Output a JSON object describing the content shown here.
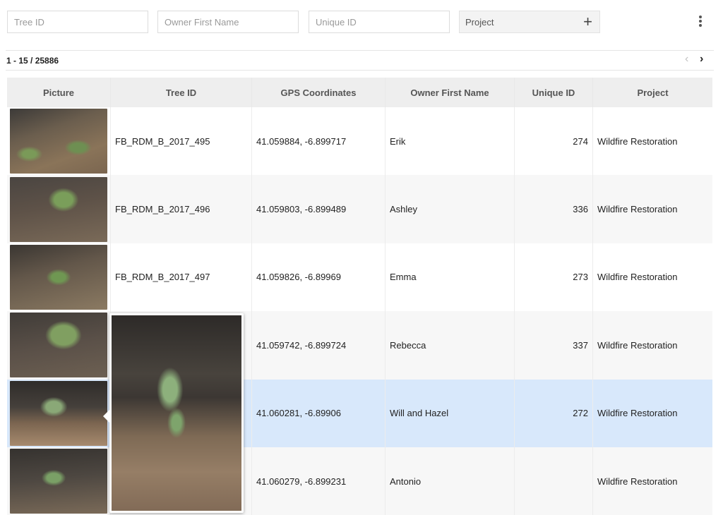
{
  "filters": {
    "tree_id_placeholder": "Tree ID",
    "owner_first_name_placeholder": "Owner First Name",
    "unique_id_placeholder": "Unique ID",
    "project_label": "Project",
    "project_icon": "plus-icon",
    "more_icon": "more-vertical-icon"
  },
  "pager": {
    "range": "1 - 15 / 25886",
    "prev_icon": "‹",
    "next_icon": "›",
    "prev_enabled": false,
    "next_enabled": true
  },
  "table": {
    "columns": [
      "Picture",
      "Tree ID",
      "GPS Coordinates",
      "Owner First Name",
      "Unique ID",
      "Project"
    ],
    "rows": [
      {
        "picture": "sapling-photo",
        "tree_id": "FB_RDM_B_2017_495",
        "gps": "41.059884, -6.899717",
        "owner": "Erik",
        "unique_id": "274",
        "project": "Wildfire Restoration"
      },
      {
        "picture": "sapling-photo",
        "tree_id": "FB_RDM_B_2017_496",
        "gps": "41.059803, -6.899489",
        "owner": "Ashley",
        "unique_id": "336",
        "project": "Wildfire Restoration"
      },
      {
        "picture": "sapling-photo",
        "tree_id": "FB_RDM_B_2017_497",
        "gps": "41.059826, -6.89969",
        "owner": "Emma",
        "unique_id": "273",
        "project": "Wildfire Restoration"
      },
      {
        "picture": "sapling-photo",
        "tree_id": "",
        "gps": "41.059742, -6.899724",
        "owner": "Rebecca",
        "unique_id": "337",
        "project": "Wildfire Restoration"
      },
      {
        "picture": "sapling-photo",
        "tree_id": "",
        "gps": "41.060281, -6.89906",
        "owner": "Will and Hazel",
        "unique_id": "272",
        "project": "Wildfire Restoration",
        "selected": true
      },
      {
        "picture": "sapling-photo",
        "tree_id": "",
        "gps": "41.060279, -6.899231",
        "owner": "Antonio",
        "unique_id": "",
        "project": "Wildfire Restoration"
      }
    ]
  },
  "colors": {
    "selected_row": "#d8e8fb",
    "header_bg": "#eeeeee",
    "zebra_row": "#f7f7f7"
  },
  "popover": {
    "visible": true,
    "content": "enlarged-sapling-photo"
  }
}
